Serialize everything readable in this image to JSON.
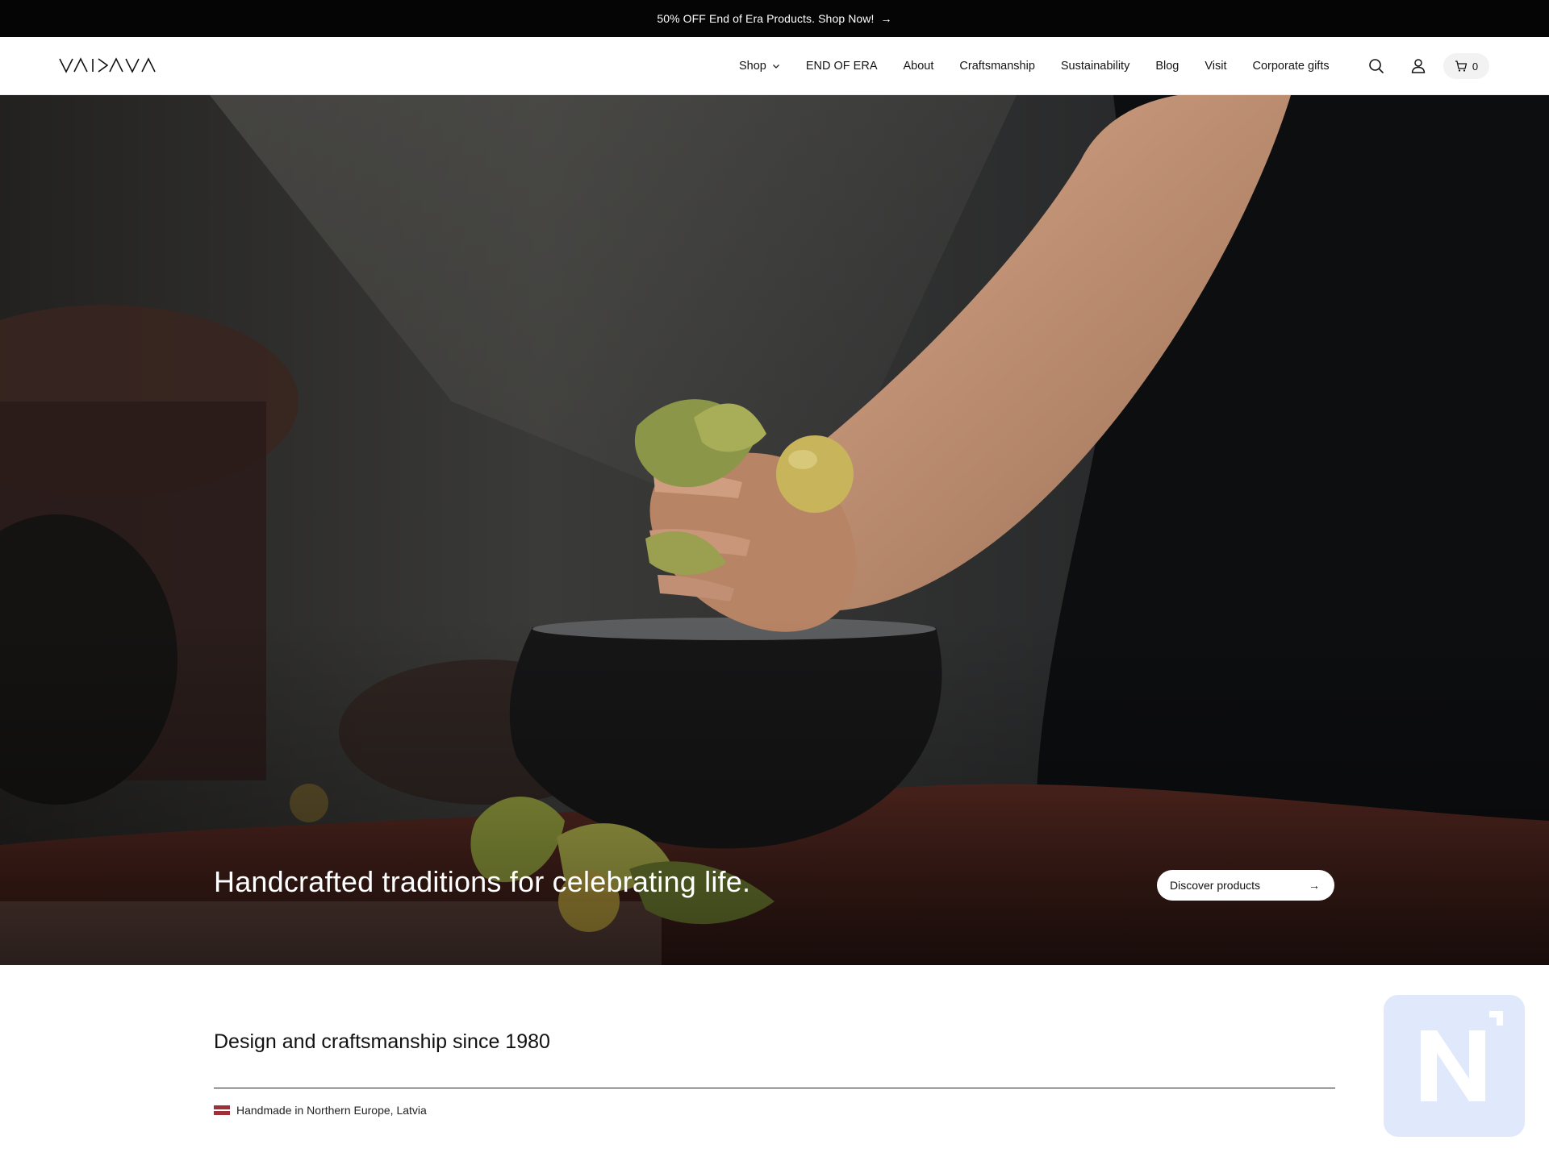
{
  "announcement": {
    "text": "50% OFF End of Era Products. Shop Now!"
  },
  "header": {
    "logo_text": "VAIDAVA",
    "nav": [
      {
        "label": "Shop",
        "has_dropdown": true
      },
      {
        "label": "END OF ERA"
      },
      {
        "label": "About"
      },
      {
        "label": "Craftsmanship"
      },
      {
        "label": "Sustainability"
      },
      {
        "label": "Blog"
      },
      {
        "label": "Visit"
      },
      {
        "label": "Corporate gifts"
      }
    ],
    "icons": [
      "search-icon",
      "account-icon",
      "cart-icon"
    ],
    "cart_count": "0"
  },
  "hero": {
    "title": "Handcrafted traditions for celebrating life.",
    "button_label": "Discover products"
  },
  "intro": {
    "heading": "Design and craftsmanship since 1980",
    "origin_text": "Handmade in Northern Europe, Latvia"
  },
  "colors": {
    "announcement_bg": "#050505",
    "badge_bg": "#dfe9fb",
    "flag_red": "#9e3039"
  }
}
